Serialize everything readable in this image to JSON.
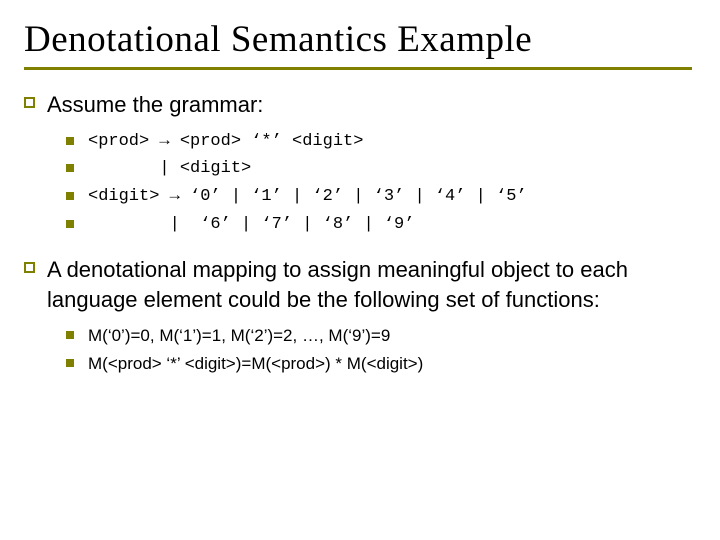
{
  "title": "Denotational Semantics Example",
  "sections": [
    {
      "heading": "Assume the grammar:",
      "items": [
        {
          "mono": true,
          "text": "<prod> → <prod> ‘*’ <digit>"
        },
        {
          "mono": true,
          "text": "       | <digit>"
        },
        {
          "mono": true,
          "text": "<digit> → ‘0’ | ‘1’ | ‘2’ | ‘3’ | ‘4’ | ‘5’"
        },
        {
          "mono": true,
          "text": "        |  ‘6’ | ‘7’ | ‘8’ | ‘9’"
        }
      ]
    },
    {
      "heading": "A denotational mapping to assign meaningful object to each language element could be the following set of functions:",
      "items": [
        {
          "mono": false,
          "text": "M(‘0’)=0, M(‘1’)=1, M(‘2’)=2, …, M(‘9’)=9"
        },
        {
          "mono": false,
          "text": "M(<prod> ‘*’ <digit>)=M(<prod>) * M(<digit>)"
        }
      ]
    }
  ]
}
